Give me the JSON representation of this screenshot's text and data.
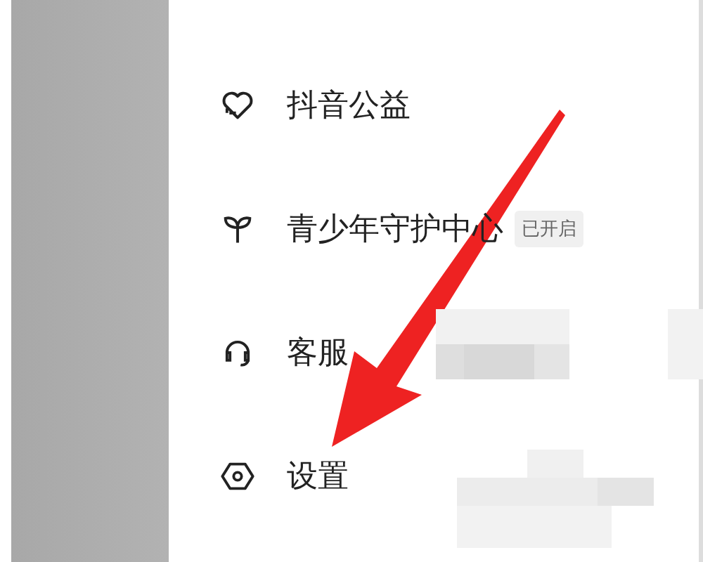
{
  "menu": {
    "items": [
      {
        "kind": "charity",
        "label": "抖音公益"
      },
      {
        "kind": "youth",
        "label": "青少年守护中心",
        "badge": "已开启"
      },
      {
        "kind": "service",
        "label": "客服"
      },
      {
        "kind": "settings",
        "label": "设置"
      }
    ]
  }
}
